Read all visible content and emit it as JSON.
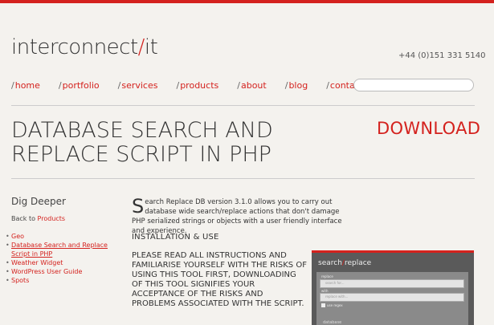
{
  "header": {
    "logo_main": "interconnect",
    "logo_slash": "/",
    "logo_it": "it",
    "phone": "+44 (0)151 331 5140"
  },
  "nav": {
    "items": [
      {
        "slash": "/",
        "label": "home"
      },
      {
        "slash": "/",
        "label": "portfolio"
      },
      {
        "slash": "/",
        "label": "services"
      },
      {
        "slash": "/",
        "label": "products"
      },
      {
        "slash": "/",
        "label": "about"
      },
      {
        "slash": "/",
        "label": "blog"
      },
      {
        "slash": "/",
        "label": "contact"
      }
    ],
    "search_placeholder": ""
  },
  "page": {
    "title": "DATABASE SEARCH AND REPLACE SCRIPT IN PHP",
    "download_label": "DOWNLOAD"
  },
  "sidebar": {
    "heading": "Dig Deeper",
    "back_prefix": "Back to",
    "back_link": "Products",
    "items": [
      {
        "label": "Geo"
      },
      {
        "label": "Database Search and Replace Script in PHP"
      },
      {
        "label": "Weather Widget"
      },
      {
        "label": "WordPress User Guide"
      },
      {
        "label": "Spots"
      }
    ]
  },
  "main": {
    "intro_dropcap": "S",
    "intro_rest": "earch Replace DB version 3.1.0 allows you to carry out database wide search/replace actions that don't damage PHP serialized strings or objects with a user friendly interface and experience.",
    "install_heading": "INSTALLATION & USE",
    "warning": "PLEASE READ ALL INSTRUCTIONS AND FAMILIARISE YOURSELF WITH THE RISKS OF USING THIS TOOL FIRST, DOWNLOADING OF THIS TOOL SIGNIFIES YOUR ACCEPTANCE OF THE RISKS AND PROBLEMS ASSOCIATED WITH THE SCRIPT."
  },
  "preview": {
    "title_a": "search",
    "title_slash": "/",
    "title_b": "replace",
    "replace_label": "replace",
    "replace_placeholder": "search for...",
    "with_label": "with",
    "with_placeholder": "replace with...",
    "regex_label": "use regex",
    "database_label": "database"
  },
  "colors": {
    "accent": "#d4221e",
    "background": "#f4f2ee"
  }
}
